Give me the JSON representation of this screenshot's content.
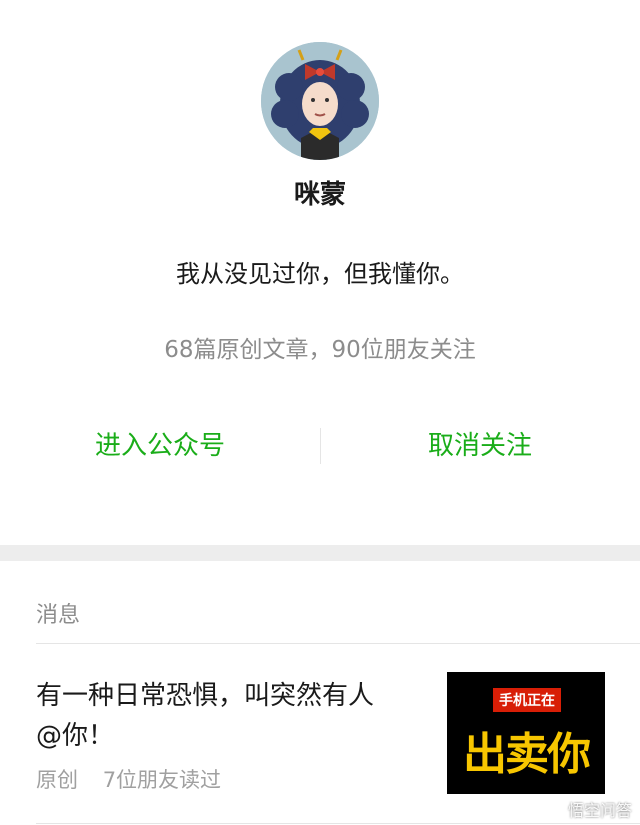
{
  "profile": {
    "avatar_icon": "illustrated-girl-avatar",
    "name": "咪蒙",
    "slogan": "我从没见过你，但我懂你。",
    "stats": "68篇原创文章，90位朋友关注"
  },
  "actions": {
    "enter_account": "进入公众号",
    "unfollow": "取消关注"
  },
  "colors": {
    "accent_green": "#1aad19",
    "thumb_red": "#d81e06",
    "thumb_yellow": "#f7c600"
  },
  "messages": {
    "section_title": "消息",
    "articles": [
      {
        "title": "有一种日常恐惧，叫突然有人@你！",
        "tag": "原创",
        "reads": "7位朋友读过",
        "thumbnail": {
          "top_text": "手机正在",
          "big_text": "出卖你"
        }
      }
    ]
  },
  "watermark": "悟空问答"
}
